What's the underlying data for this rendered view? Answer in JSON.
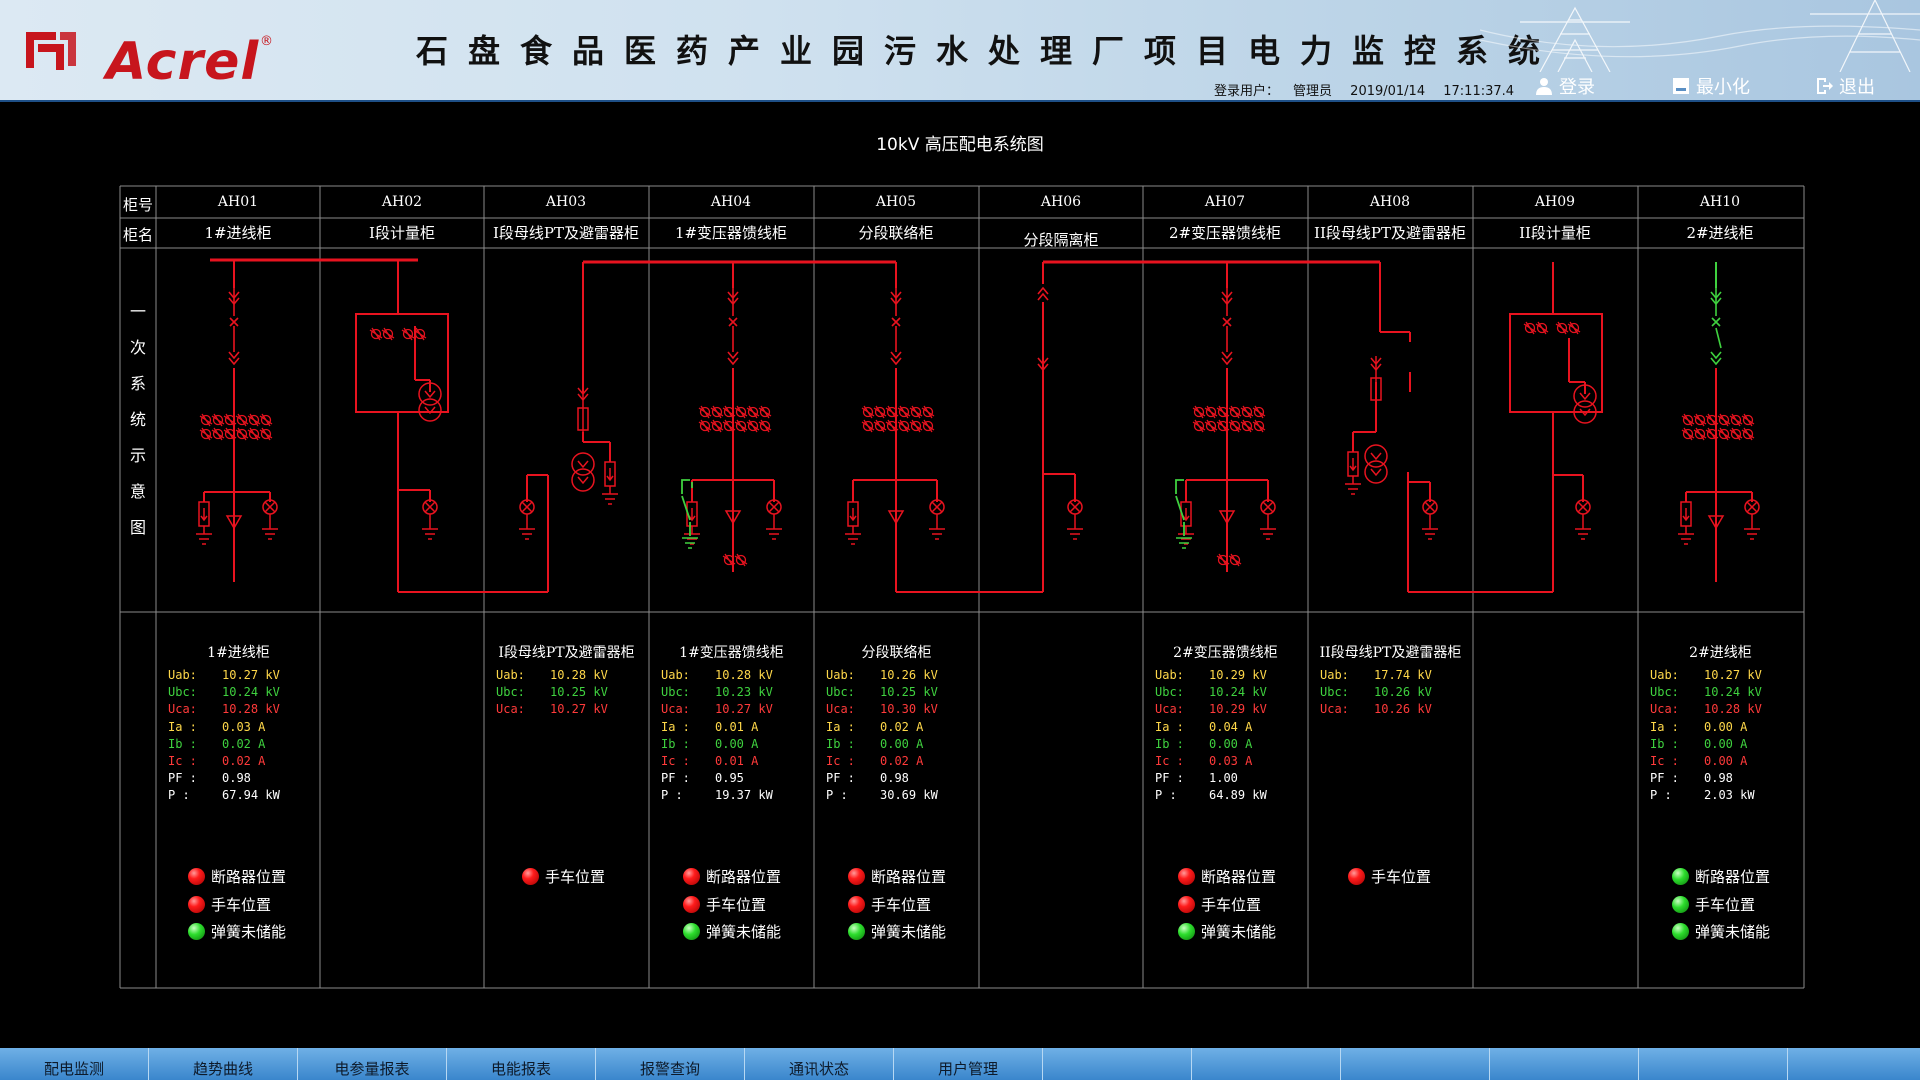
{
  "header": {
    "brand": "Acrel",
    "brand_mark": "®",
    "title": "石盘食品医药产业园污水处理厂项目电力监控系统",
    "login_user_label": "登录用户：",
    "login_user": "管理员",
    "date": "2019/01/14",
    "time": "17:11:37.4",
    "login_button": "登录",
    "minimize_button": "最小化",
    "exit_button": "退出"
  },
  "diagram": {
    "title": "10kV 高压配电系统图",
    "row_header_no": "柜号",
    "row_header_name": "柜名",
    "vertical_title": [
      "一",
      "次",
      "系",
      "统",
      "示",
      "意",
      "图"
    ],
    "colors": {
      "bus": "#e8131f",
      "open_switch": "#3fd13f",
      "frame": "#8a8a8a"
    },
    "cabinets": [
      {
        "no": "AH01",
        "name": "1#进线柜"
      },
      {
        "no": "AH02",
        "name": "I段计量柜"
      },
      {
        "no": "AH03",
        "name": "I段母线PT及避雷器柜"
      },
      {
        "no": "AH04",
        "name": "1#变压器馈线柜"
      },
      {
        "no": "AH05",
        "name": "分段联络柜"
      },
      {
        "no": "AH06",
        "name": "分段隔离柜"
      },
      {
        "no": "AH07",
        "name": "2#变压器馈线柜"
      },
      {
        "no": "AH08",
        "name": "II段母线PT及避雷器柜"
      },
      {
        "no": "AH09",
        "name": "II段计量柜"
      },
      {
        "no": "AH10",
        "name": "2#进线柜"
      }
    ]
  },
  "measurements": [
    {
      "title": "1#进线柜",
      "rows": [
        {
          "label": "Uab:",
          "value": "10.27 kV",
          "color": "y"
        },
        {
          "label": "Ubc:",
          "value": "10.24 kV",
          "color": "g"
        },
        {
          "label": "Uca:",
          "value": "10.28 kV",
          "color": "r"
        },
        {
          "label": "Ia :",
          "value": "0.03 A",
          "color": "y"
        },
        {
          "label": "Ib :",
          "value": "0.02 A",
          "color": "g"
        },
        {
          "label": "Ic :",
          "value": "0.02 A",
          "color": "r"
        },
        {
          "label": "PF :",
          "value": "0.98",
          "color": "w"
        },
        {
          "label": "P  :",
          "value": "67.94 kW",
          "color": "w"
        }
      ]
    },
    {
      "title": "I段母线PT及避雷器柜",
      "rows": [
        {
          "label": "Uab:",
          "value": "10.28 kV",
          "color": "y"
        },
        {
          "label": "Ubc:",
          "value": "10.25 kV",
          "color": "g"
        },
        {
          "label": "Uca:",
          "value": "10.27 kV",
          "color": "r"
        }
      ]
    },
    {
      "title": "1#变压器馈线柜",
      "rows": [
        {
          "label": "Uab:",
          "value": "10.28 kV",
          "color": "y"
        },
        {
          "label": "Ubc:",
          "value": "10.23 kV",
          "color": "g"
        },
        {
          "label": "Uca:",
          "value": "10.27 kV",
          "color": "r"
        },
        {
          "label": "Ia :",
          "value": "0.01 A",
          "color": "y"
        },
        {
          "label": "Ib :",
          "value": "0.00 A",
          "color": "g"
        },
        {
          "label": "Ic :",
          "value": "0.01 A",
          "color": "r"
        },
        {
          "label": "PF :",
          "value": "0.95",
          "color": "w"
        },
        {
          "label": "P  :",
          "value": "19.37 kW",
          "color": "w"
        }
      ]
    },
    {
      "title": "分段联络柜",
      "rows": [
        {
          "label": "Uab:",
          "value": "10.26 kV",
          "color": "y"
        },
        {
          "label": "Ubc:",
          "value": "10.25 kV",
          "color": "g"
        },
        {
          "label": "Uca:",
          "value": "10.30 kV",
          "color": "r"
        },
        {
          "label": "Ia :",
          "value": "0.02 A",
          "color": "y"
        },
        {
          "label": "Ib :",
          "value": "0.00 A",
          "color": "g"
        },
        {
          "label": "Ic :",
          "value": "0.02 A",
          "color": "r"
        },
        {
          "label": "PF :",
          "value": "0.98",
          "color": "w"
        },
        {
          "label": "P  :",
          "value": "30.69 kW",
          "color": "w"
        }
      ]
    },
    {
      "title": "2#变压器馈线柜",
      "rows": [
        {
          "label": "Uab:",
          "value": "10.29 kV",
          "color": "y"
        },
        {
          "label": "Ubc:",
          "value": "10.24 kV",
          "color": "g"
        },
        {
          "label": "Uca:",
          "value": "10.29 kV",
          "color": "r"
        },
        {
          "label": "Ia :",
          "value": "0.04 A",
          "color": "y"
        },
        {
          "label": "Ib :",
          "value": "0.00 A",
          "color": "g"
        },
        {
          "label": "Ic :",
          "value": "0.03 A",
          "color": "r"
        },
        {
          "label": "PF :",
          "value": "1.00",
          "color": "w"
        },
        {
          "label": "P  :",
          "value": "64.89 kW",
          "color": "w"
        }
      ]
    },
    {
      "title": "II段母线PT及避雷器柜",
      "rows": [
        {
          "label": "Uab:",
          "value": "17.74 kV",
          "color": "y"
        },
        {
          "label": "Ubc:",
          "value": "10.26 kV",
          "color": "g"
        },
        {
          "label": "Uca:",
          "value": "10.26 kV",
          "color": "r"
        }
      ]
    },
    {
      "title": "2#进线柜",
      "rows": [
        {
          "label": "Uab:",
          "value": "10.27 kV",
          "color": "y"
        },
        {
          "label": "Ubc:",
          "value": "10.24 kV",
          "color": "g"
        },
        {
          "label": "Uca:",
          "value": "10.28 kV",
          "color": "r"
        },
        {
          "label": "Ia :",
          "value": "0.00 A",
          "color": "y"
        },
        {
          "label": "Ib :",
          "value": "0.00 A",
          "color": "g"
        },
        {
          "label": "Ic :",
          "value": "0.00 A",
          "color": "r"
        },
        {
          "label": "PF :",
          "value": "0.98",
          "color": "w"
        },
        {
          "label": "P  :",
          "value": "2.03 kW",
          "color": "w"
        }
      ]
    }
  ],
  "status": [
    {
      "cabinet": "AH01",
      "items": [
        {
          "label": "断路器位置",
          "state": "red"
        },
        {
          "label": "手车位置",
          "state": "red"
        },
        {
          "label": "弹簧未储能",
          "state": "green"
        }
      ]
    },
    {
      "cabinet": "AH03",
      "items": [
        {
          "label": "手车位置",
          "state": "red"
        }
      ]
    },
    {
      "cabinet": "AH04",
      "items": [
        {
          "label": "断路器位置",
          "state": "red"
        },
        {
          "label": "手车位置",
          "state": "red"
        },
        {
          "label": "弹簧未储能",
          "state": "green"
        }
      ]
    },
    {
      "cabinet": "AH05",
      "items": [
        {
          "label": "断路器位置",
          "state": "red"
        },
        {
          "label": "手车位置",
          "state": "red"
        },
        {
          "label": "弹簧未储能",
          "state": "green"
        }
      ]
    },
    {
      "cabinet": "AH07",
      "items": [
        {
          "label": "断路器位置",
          "state": "red"
        },
        {
          "label": "手车位置",
          "state": "red"
        },
        {
          "label": "弹簧未储能",
          "state": "green"
        }
      ]
    },
    {
      "cabinet": "AH08",
      "items": [
        {
          "label": "手车位置",
          "state": "red"
        }
      ]
    },
    {
      "cabinet": "AH10",
      "items": [
        {
          "label": "断路器位置",
          "state": "green"
        },
        {
          "label": "手车位置",
          "state": "green"
        },
        {
          "label": "弹簧未储能",
          "state": "green"
        }
      ]
    }
  ],
  "nav": {
    "tabs": [
      "配电监测",
      "趋势曲线",
      "电参量报表",
      "电能报表",
      "报警查询",
      "通讯状态",
      "用户管理",
      "",
      "",
      "",
      "",
      "",
      ""
    ]
  }
}
